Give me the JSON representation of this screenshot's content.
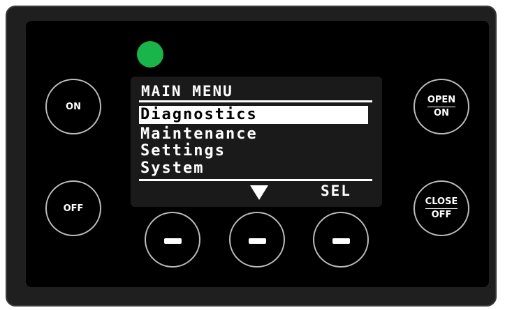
{
  "buttons": {
    "left_top": "ON",
    "left_bottom": "OFF",
    "right_top": {
      "top": "OPEN",
      "bottom": "ON"
    },
    "right_bottom": {
      "top": "CLOSE",
      "bottom": "OFF"
    }
  },
  "status_led": {
    "color": "#19b44a",
    "state": "on"
  },
  "screen": {
    "title": "MAIN MENU",
    "items": [
      {
        "label": "Diagnostics",
        "selected": true
      },
      {
        "label": "Maintenance",
        "selected": false
      },
      {
        "label": "Settings",
        "selected": false
      },
      {
        "label": "System",
        "selected": false
      }
    ],
    "softkeys": {
      "left": "",
      "middle_icon": "triangle-down-icon",
      "right": "SEL"
    }
  },
  "soft_buttons": [
    {
      "icon": "minus-icon"
    },
    {
      "icon": "minus-icon"
    },
    {
      "icon": "minus-icon"
    }
  ]
}
